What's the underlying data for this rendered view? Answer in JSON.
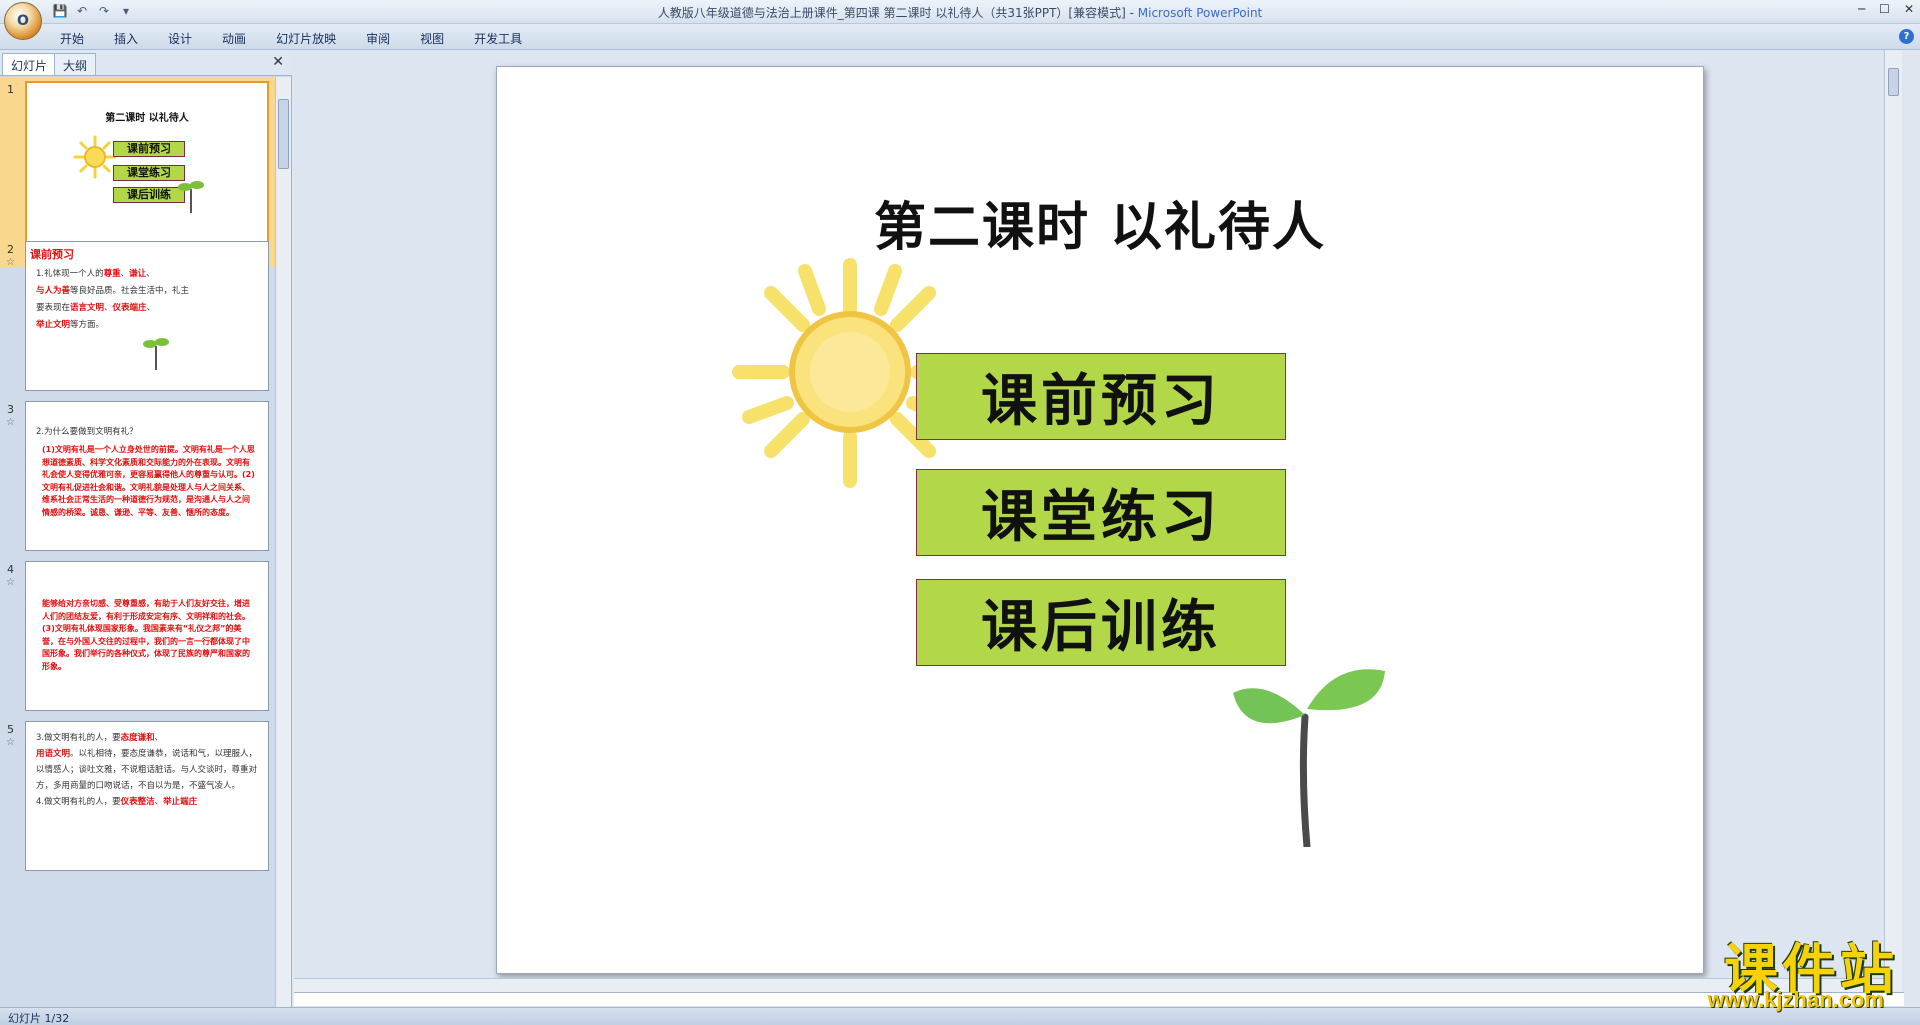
{
  "titlebar": {
    "document_title": "人教版八年级道德与法治上册课件_第四课 第二课时  以礼待人（共31张PPT）[兼容模式]",
    "separator": " - ",
    "app_name": "Microsoft PowerPoint",
    "office_button_label": "O"
  },
  "menu": {
    "items": [
      "开始",
      "插入",
      "设计",
      "动画",
      "幻灯片放映",
      "审阅",
      "视图",
      "开发工具"
    ]
  },
  "panel": {
    "tabs": [
      "幻灯片",
      "大纲"
    ],
    "close": "✕"
  },
  "thumbnails": [
    {
      "number": "1",
      "title": "第二课时  以礼待人",
      "buttons": [
        "课前预习",
        "课堂练习",
        "课后训练"
      ]
    },
    {
      "number": "2",
      "star": "☆",
      "heading": "课前预习",
      "line1_prefix": "1.礼体现一个人的",
      "blank1": "尊重",
      "blank2": "谦让",
      "blank3": "与人为善",
      "line2_mid": "等良好品质。社会生活中，礼主",
      "line3_prefix": "要表现在",
      "blank4": "语言文明",
      "blank5": "仪表端庄",
      "blank6": "举止文明",
      "line4_suffix": "等方面。"
    },
    {
      "number": "3",
      "star": "☆",
      "question": "2.为什么要做到文明有礼？",
      "answer": "(1)文明有礼是一个人立身处世的前提。文明有礼是一个人思想道德素质、科学文化素质和交际能力的外在表现。文明有礼会使人变得优雅可亲，更容易赢得他人的尊重与认可。(2)文明有礼促进社会和谐。文明礼貌是处理人与人之间关系、维系社会正常生活的一种道德行为规范，是沟通人与人之间情感的桥梁。诚恳、谦逊、平等、友善、惬所的态度。"
    },
    {
      "number": "4",
      "star": "☆",
      "answer": "能够给对方亲切感、受尊重感，有助于人们友好交往，增进人们的团结友爱，有利于形成安定有序、文明祥和的社会。(3)文明有礼体现国家形象。我国素来有“礼仪之邦”的美誉，在与外国人交往的过程中，我们的一言一行都体现了中国形象。我们举行的各种仪式，体现了民族的尊严和国家的形象。"
    },
    {
      "number": "5",
      "star": "☆",
      "line1_prefix": "3.做文明有礼的人，要",
      "blank1": "态度谦和",
      "blank2": "用语文明",
      "text2": "。以礼相待，要态度谦恭，说话和气，以理服人，以情感人；谈吐文雅，不说粗话脏话。与人交谈时，尊重对方，多用商量的口吻说话，不自以为是，不盛气凌人。",
      "line4_prefix": "4.做文明有礼的人，要",
      "blank3": "仪表整洁",
      "blank4": "举止端庄"
    }
  ],
  "slide": {
    "title": "第二课时  以礼待人",
    "buttons": [
      "课前预习",
      "课堂练习",
      "课后训练"
    ]
  },
  "status": {
    "slide_indicator": "幻灯片 1/32"
  },
  "watermark": {
    "cn": "课件站",
    "url": "www.kjzhan.com"
  },
  "colors": {
    "accent_green": "#b2d849",
    "box_border": "#8a2a4e",
    "sun_yellow": "#f4d23a",
    "highlight_red": "#e01010",
    "selected_thumb": "#fad78e"
  }
}
